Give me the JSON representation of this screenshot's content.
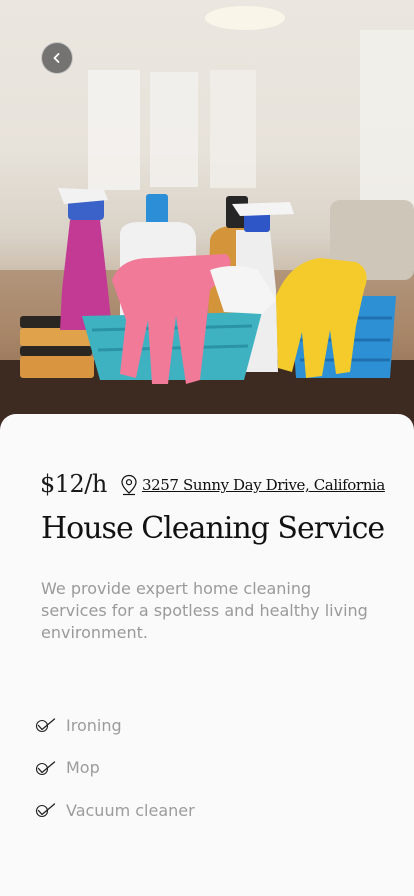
{
  "hero": {
    "image_description": "cleaning supplies photo",
    "back_icon": "chevron-left-icon"
  },
  "service": {
    "price": "$12/h",
    "location_icon": "map-pin-icon",
    "address": "3257 Sunny Day Drive, California",
    "title": "House Cleaning Service",
    "description": "We provide expert home cleaning services for a spotless and healthy living environment."
  },
  "features": [
    {
      "icon": "check-icon",
      "label": "Ironing"
    },
    {
      "icon": "check-icon",
      "label": "Mop"
    },
    {
      "icon": "check-icon",
      "label": "Vacuum cleaner"
    }
  ],
  "colors": {
    "text": "#111111",
    "muted": "#9a9a9a",
    "sheet": "#fafafa"
  }
}
